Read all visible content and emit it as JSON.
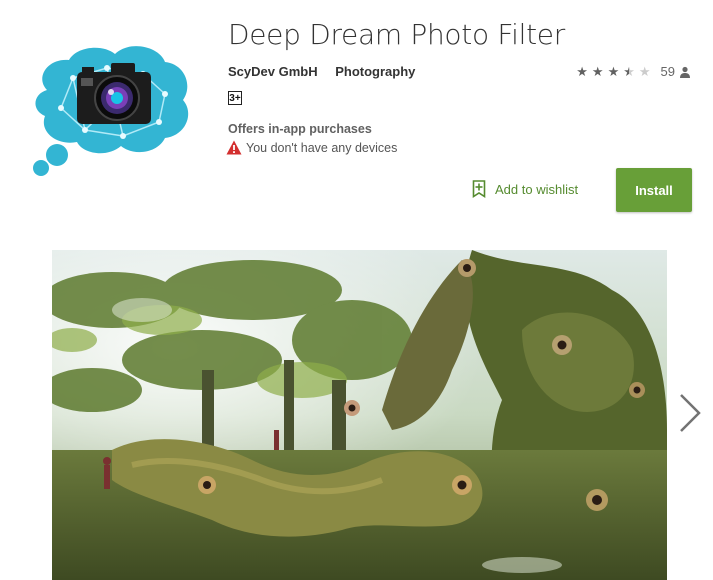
{
  "app": {
    "title": "Deep Dream Photo Filter",
    "developer": "ScyDev GmbH",
    "category": "Photography",
    "content_rating": "3+",
    "in_app_purchases": "Offers in-app purchases",
    "device_warning": "You don't have any devices"
  },
  "rating": {
    "stars": 3.5,
    "count": "59"
  },
  "actions": {
    "wishlist_label": "Add to wishlist",
    "install_label": "Install"
  },
  "colors": {
    "install_button": "#689f38",
    "wishlist_text": "#558b2f",
    "icon_brain": "#33b5d3",
    "warning": "#d32f2f"
  },
  "icons": [
    "brain-camera-app-icon",
    "star-icon",
    "person-icon",
    "warning-icon",
    "bookmark-add-icon",
    "chevron-right-icon"
  ]
}
